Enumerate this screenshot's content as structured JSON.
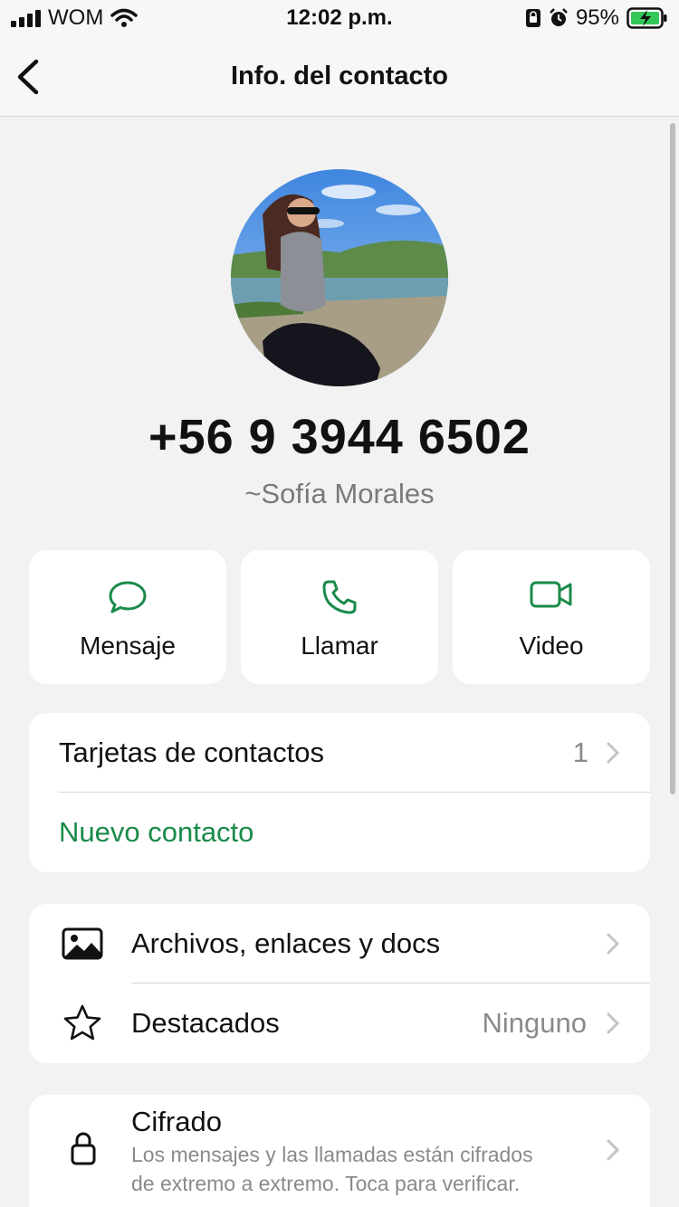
{
  "status_bar": {
    "carrier": "WOM",
    "time": "12:02 p.m.",
    "battery": "95%"
  },
  "nav": {
    "back_icon": "chevron-left-icon",
    "title": "Info. del contacto"
  },
  "profile": {
    "phone": "+56 9 3944 6502",
    "alias": "~Sofía Morales"
  },
  "actions": [
    {
      "label": "Mensaje",
      "icon": "chat-bubble-icon"
    },
    {
      "label": "Llamar",
      "icon": "phone-icon"
    },
    {
      "label": "Video",
      "icon": "video-camera-icon"
    }
  ],
  "contact_card": {
    "cards_label": "Tarjetas de contactos",
    "cards_count": "1",
    "new_contact": "Nuevo contacto"
  },
  "media_card": {
    "files_label": "Archivos, enlaces y docs",
    "starred_label": "Destacados",
    "starred_value": "Ninguno"
  },
  "encryption": {
    "title": "Cifrado",
    "line1": "Los mensajes y las llamadas están cifrados",
    "line2": "de extremo a extremo. Toca para verificar."
  },
  "colors": {
    "accent": "#1a8a4a",
    "background": "#f2f2f2",
    "battery": "#34c759"
  }
}
